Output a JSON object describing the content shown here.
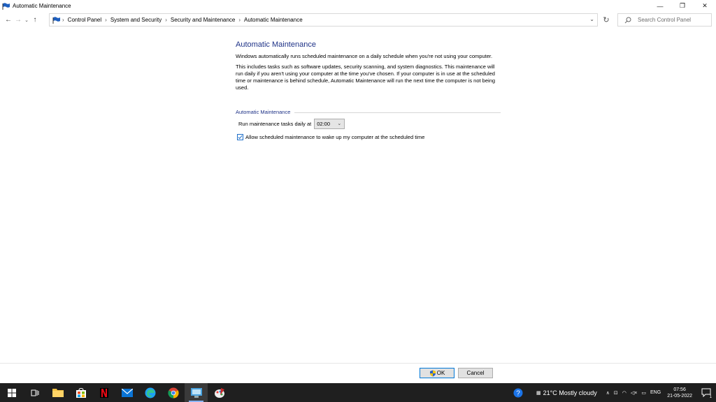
{
  "window": {
    "title": "Automatic Maintenance",
    "controls": {
      "minimize": "—",
      "restore": "❐",
      "close": "✕"
    }
  },
  "nav": {
    "back": "←",
    "forward": "→",
    "recent": "⌄",
    "up": "↑",
    "breadcrumbs": [
      "Control Panel",
      "System and Security",
      "Security and Maintenance",
      "Automatic Maintenance"
    ],
    "separator": "›",
    "dropdown": "⌄",
    "refresh": "↻",
    "search_placeholder": "Search Control Panel"
  },
  "main": {
    "title": "Automatic Maintenance",
    "para1": "Windows automatically runs scheduled maintenance on a daily schedule when you're not using your computer.",
    "para2": "This includes tasks such as software updates, security scanning, and system diagnostics. This maintenance will run daily if you aren't using your computer at the time you've chosen. If your computer is in use at the scheduled time or maintenance is behind schedule, Automatic Maintenance will run the next time the computer is not being used.",
    "group_label": "Automatic Maintenance",
    "run_label": "Run maintenance tasks daily at",
    "run_time": "02:00",
    "wake_label": "Allow scheduled maintenance to wake up my computer at the scheduled time",
    "wake_checked": true
  },
  "buttons": {
    "ok": "OK",
    "cancel": "Cancel"
  },
  "taskbar": {
    "weather": "21°C  Mostly cloudy",
    "language": "ENG",
    "time": "07:56",
    "date": "21-05-2022",
    "notifications": "1"
  },
  "colors": {
    "accent": "#1e3287",
    "taskbar": "#1f1f1f",
    "check": "#1e6fc9"
  }
}
